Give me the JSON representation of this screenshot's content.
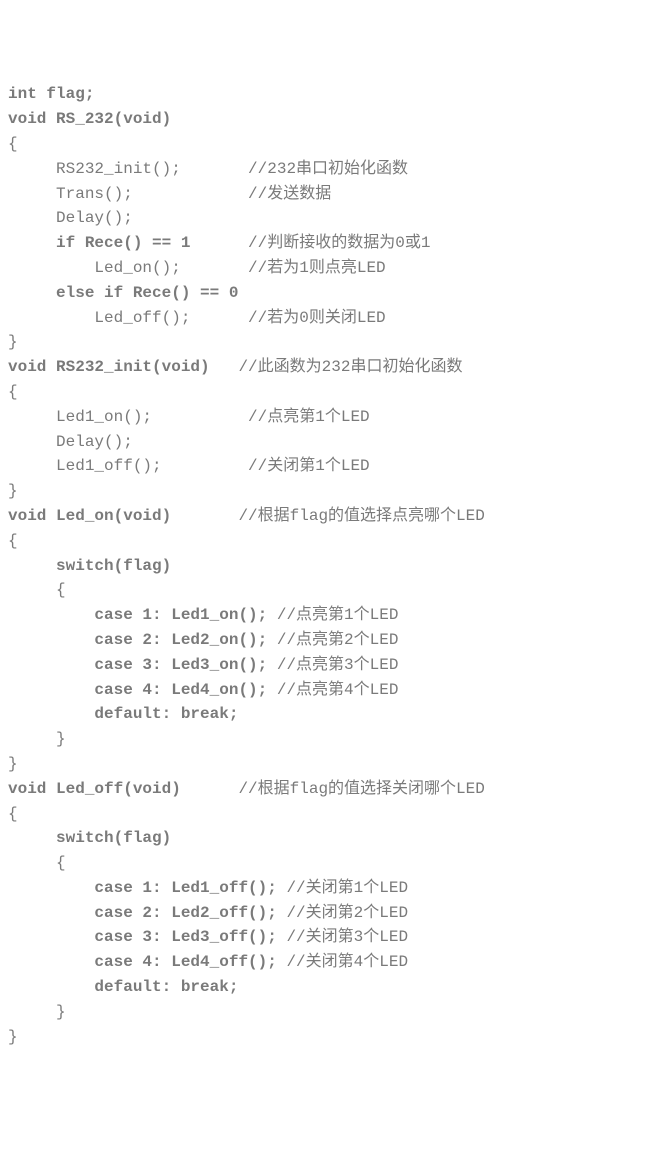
{
  "lines": [
    {
      "code": "int flag;",
      "bold": true,
      "comment": ""
    },
    {
      "code": "void RS_232(void)",
      "bold": true,
      "comment": ""
    },
    {
      "code": "{",
      "comment": ""
    },
    {
      "code": "     RS232_init();       ",
      "comment": "//232串口初始化函数"
    },
    {
      "code": "     Trans();            ",
      "comment": "//发送数据"
    },
    {
      "code": "     Delay();",
      "comment": ""
    },
    {
      "code": "     if Rece() == 1      ",
      "bold": true,
      "comment": "//判断接收的数据为0或1"
    },
    {
      "code": "         Led_on();       ",
      "comment": "//若为1则点亮LED"
    },
    {
      "code": "     else if Rece() == 0",
      "bold": true,
      "comment": ""
    },
    {
      "code": "         Led_off();      ",
      "comment": "//若为0则关闭LED"
    },
    {
      "code": "}",
      "comment": ""
    },
    {
      "code": "void RS232_init(void)   ",
      "bold": true,
      "comment": "//此函数为232串口初始化函数"
    },
    {
      "code": "{",
      "comment": ""
    },
    {
      "code": "     Led1_on();          ",
      "comment": "//点亮第1个LED"
    },
    {
      "code": "     Delay();",
      "comment": ""
    },
    {
      "code": "     Led1_off();         ",
      "comment": "//关闭第1个LED"
    },
    {
      "code": "}",
      "comment": ""
    },
    {
      "code": "void Led_on(void)       ",
      "bold": true,
      "comment": "//根据flag的值选择点亮哪个LED"
    },
    {
      "code": "{",
      "comment": ""
    },
    {
      "code": "     switch(flag)",
      "bold": true,
      "comment": ""
    },
    {
      "code": "     {",
      "comment": ""
    },
    {
      "code": "         case 1: Led1_on(); ",
      "bold": true,
      "comment": "//点亮第1个LED"
    },
    {
      "code": "         case 2: Led2_on(); ",
      "bold": true,
      "comment": "//点亮第2个LED"
    },
    {
      "code": "         case 3: Led3_on(); ",
      "bold": true,
      "comment": "//点亮第3个LED"
    },
    {
      "code": "         case 4: Led4_on(); ",
      "bold": true,
      "comment": "//点亮第4个LED"
    },
    {
      "code": "         default: break;",
      "bold": true,
      "comment": ""
    },
    {
      "code": "     }",
      "comment": ""
    },
    {
      "code": "}",
      "comment": ""
    },
    {
      "code": "void Led_off(void)      ",
      "bold": true,
      "comment": "//根据flag的值选择关闭哪个LED"
    },
    {
      "code": "{",
      "comment": ""
    },
    {
      "code": "     switch(flag)",
      "bold": true,
      "comment": ""
    },
    {
      "code": "     {",
      "comment": ""
    },
    {
      "code": "         case 1: Led1_off(); ",
      "bold": true,
      "comment": "//关闭第1个LED"
    },
    {
      "code": "         case 2: Led2_off(); ",
      "bold": true,
      "comment": "//关闭第2个LED"
    },
    {
      "code": "         case 3: Led3_off(); ",
      "bold": true,
      "comment": "//关闭第3个LED"
    },
    {
      "code": "         case 4: Led4_off(); ",
      "bold": true,
      "comment": "//关闭第4个LED"
    },
    {
      "code": "         default: break;",
      "bold": true,
      "comment": ""
    },
    {
      "code": "     }",
      "comment": ""
    },
    {
      "code": "}",
      "comment": ""
    }
  ]
}
